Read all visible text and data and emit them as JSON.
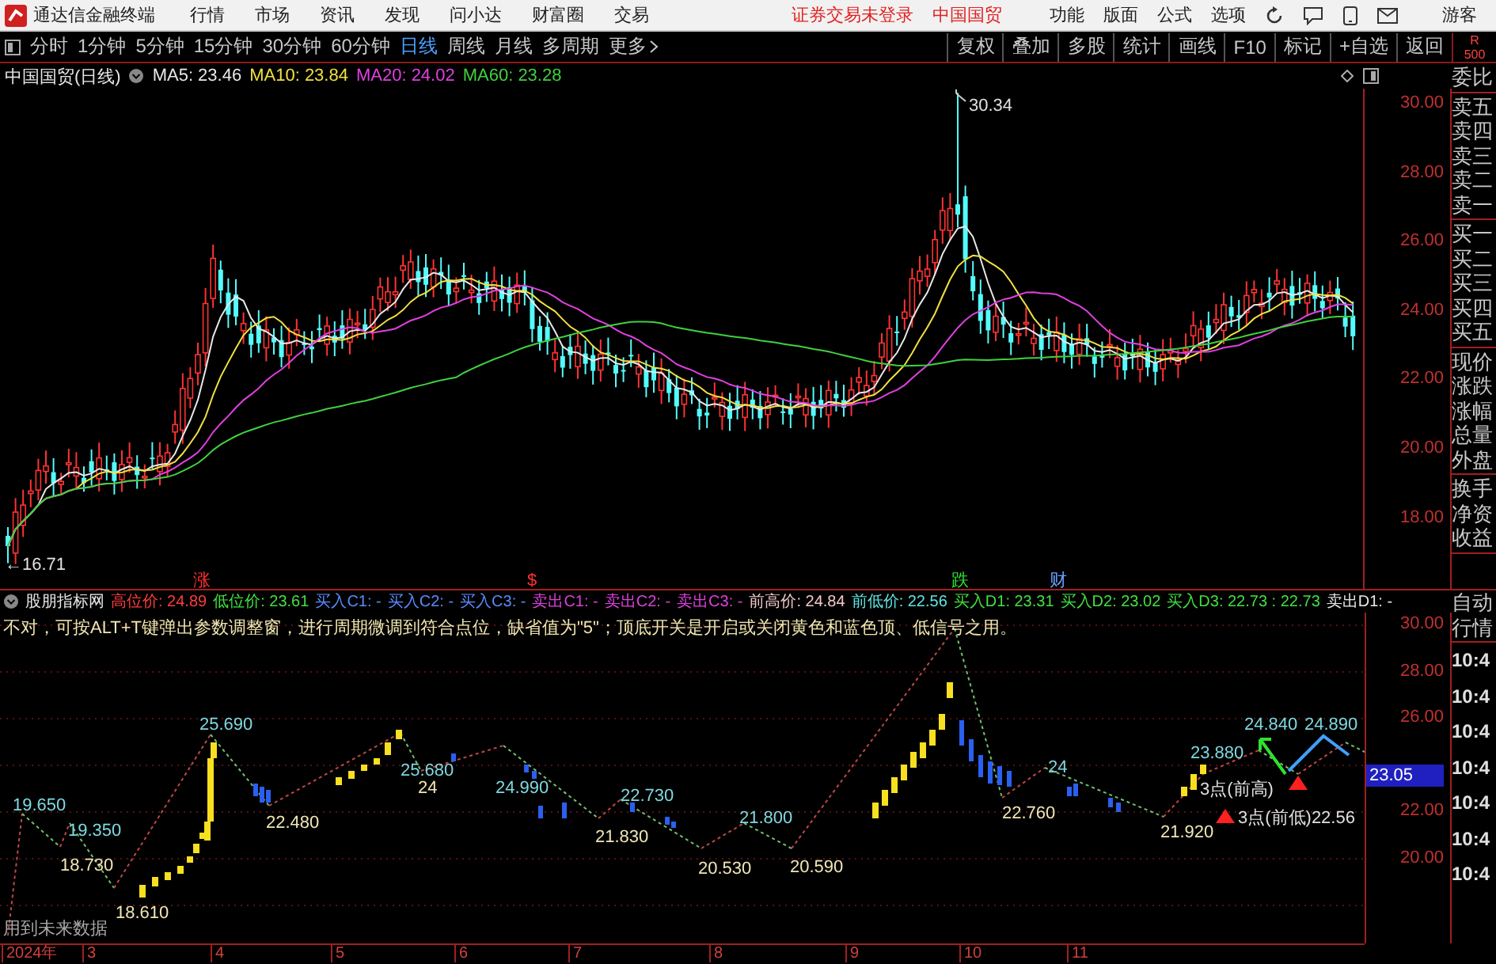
{
  "app_bar": {
    "title": "通达信金融终端",
    "menus": [
      "行情",
      "市场",
      "资讯",
      "发现",
      "问小达",
      "财富圈",
      "交易"
    ],
    "notices": [
      "证券交易未登录",
      "中国国贸"
    ],
    "actions": [
      "功能",
      "版面",
      "公式",
      "选项"
    ],
    "user": "游客"
  },
  "period_bar": {
    "periods": [
      {
        "label": "分时",
        "kind": "period",
        "selected": false
      },
      {
        "label": "1分钟",
        "kind": "period",
        "selected": false
      },
      {
        "label": "5分钟",
        "kind": "period",
        "selected": false
      },
      {
        "label": "15分钟",
        "kind": "period",
        "selected": false
      },
      {
        "label": "30分钟",
        "kind": "period",
        "selected": false
      },
      {
        "label": "60分钟",
        "kind": "period",
        "selected": false
      },
      {
        "label": "日线",
        "kind": "period",
        "selected": true
      },
      {
        "label": "周线",
        "kind": "period",
        "selected": false
      },
      {
        "label": "月线",
        "kind": "period",
        "selected": false
      },
      {
        "label": "多周期",
        "kind": "period",
        "selected": false
      },
      {
        "label": "更多",
        "kind": "menu",
        "selected": false
      }
    ],
    "tools": [
      "复权",
      "叠加",
      "多股",
      "统计",
      "画线",
      "F10",
      "标记",
      "+自选",
      "返回"
    ],
    "corner": [
      "R",
      "500"
    ]
  },
  "price_chart": {
    "title": "中国国贸(日线)",
    "ma": [
      {
        "text": "MA5: 23.46",
        "color": "#e8e8e8"
      },
      {
        "text": "MA10: 23.84",
        "color": "#f0e040"
      },
      {
        "text": "MA20: 24.02",
        "color": "#e040e0"
      },
      {
        "text": "MA60: 23.28",
        "color": "#40d040"
      }
    ],
    "y_axis": [
      "30.00",
      "28.00",
      "26.00",
      "24.00",
      "22.00",
      "20.00",
      "18.00"
    ],
    "high_mark": "30.34",
    "low_mark": "←16.71",
    "events": [
      {
        "text": "涨",
        "color": "#ff3030"
      },
      {
        "text": "$",
        "color": "#ff3030"
      },
      {
        "text": "跌",
        "color": "#30e030"
      },
      {
        "text": "财",
        "color": "#6aa0ff"
      }
    ]
  },
  "indicator": {
    "title": "股朋指标网",
    "readouts": [
      {
        "text": "高位价: 24.89",
        "color": "#ff3c3c"
      },
      {
        "text": "低位价: 23.61",
        "color": "#40e040"
      },
      {
        "text": "买入C1: -",
        "color": "#5a8cff"
      },
      {
        "text": "买入C2: -",
        "color": "#5a8cff"
      },
      {
        "text": "买入C3: -",
        "color": "#5a8cff"
      },
      {
        "text": "卖出C1: -",
        "color": "#e040e0"
      },
      {
        "text": "卖出C2: -",
        "color": "#e040e0"
      },
      {
        "text": "卖出C3: -",
        "color": "#e040e0"
      },
      {
        "text": "前高价: 24.84",
        "color": "#f0c8c8"
      },
      {
        "text": "前低价: 22.56",
        "color": "#60e0e0"
      },
      {
        "text": "买入D1: 23.31",
        "color": "#40e040"
      },
      {
        "text": "买入D2: 23.02",
        "color": "#40e040"
      },
      {
        "text": "买入D3: 22.73 : 22.73",
        "color": "#40e040"
      },
      {
        "text": "卖出D1: -",
        "color": "#e8e8e8"
      }
    ],
    "note": "不对，可按ALT+T键弹出参数调整窗，进行周期微调到符合点位，缺省值为\"5\"；顶底开关是开启或关闭黄色和蓝色顶、低信号之用。",
    "y_axis": [
      "30.00",
      "28.00",
      "26.00",
      "22.00",
      "20.00"
    ],
    "current": "23.05",
    "pivots": [
      {
        "text": "19.650",
        "kind": "high"
      },
      {
        "text": "18.730",
        "kind": "low"
      },
      {
        "text": "19.350",
        "kind": "high"
      },
      {
        "text": "18.610",
        "kind": "low"
      },
      {
        "text": "25.690",
        "kind": "high"
      },
      {
        "text": "22.480",
        "kind": "low"
      },
      {
        "text": "25.680",
        "kind": "high"
      },
      {
        "text": "24",
        "kind": "low"
      },
      {
        "text": "24.990",
        "kind": "high"
      },
      {
        "text": "21.830",
        "kind": "low"
      },
      {
        "text": "22.730",
        "kind": "high"
      },
      {
        "text": "20.530",
        "kind": "low"
      },
      {
        "text": "21.800",
        "kind": "high"
      },
      {
        "text": "20.590",
        "kind": "low"
      },
      {
        "text": "22.760",
        "kind": "low"
      },
      {
        "text": "24",
        "kind": "high"
      },
      {
        "text": "21.920",
        "kind": "low"
      },
      {
        "text": "23.880",
        "kind": "high"
      },
      {
        "text": "24.840",
        "kind": "high"
      },
      {
        "text": "24.890",
        "kind": "high"
      },
      {
        "text": "3点(前高)",
        "kind": "note"
      },
      {
        "text": "3点(前低)22.56",
        "kind": "note"
      }
    ],
    "warning": "用到未来数据"
  },
  "time_axis": [
    "2024年",
    "3",
    "4",
    "5",
    "6",
    "7",
    "8",
    "9",
    "10",
    "11"
  ],
  "sidebar": {
    "quote_groups": [
      [
        "委比"
      ],
      [
        "卖五",
        "卖四",
        "卖三",
        "卖二",
        "卖一"
      ],
      [
        "买一",
        "买二",
        "买三",
        "买四",
        "买五"
      ],
      [
        "现价",
        "涨跌",
        "涨幅",
        "总量",
        "外盘"
      ],
      [
        "换手",
        "净资",
        "收益"
      ]
    ],
    "mode": [
      "自动",
      "行情"
    ],
    "times": [
      "10:4",
      "10:4",
      "10:4",
      "10:4",
      "10:4",
      "10:4",
      "10:4"
    ]
  }
}
